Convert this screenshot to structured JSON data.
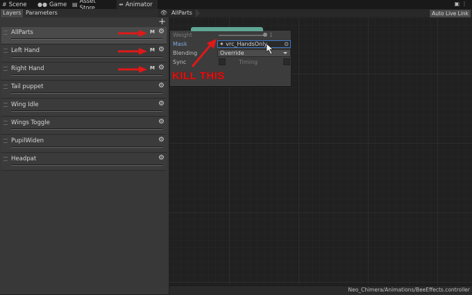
{
  "tabs": [
    {
      "label": "Scene",
      "icon": "grid-icon"
    },
    {
      "label": "Game",
      "icon": "gamepad-icon"
    },
    {
      "label": "Asset Store",
      "icon": "store-icon"
    },
    {
      "label": "Animator",
      "icon": "animator-icon"
    }
  ],
  "subtabs": [
    "Layers",
    "Parameters"
  ],
  "add_symbol": "+",
  "layers": [
    {
      "name": "AllParts",
      "badge": "M",
      "selected": true
    },
    {
      "name": "Left Hand",
      "badge": "M"
    },
    {
      "name": "Right Hand",
      "badge": "M"
    },
    {
      "name": "Tail puppet"
    },
    {
      "name": "Wing Idle"
    },
    {
      "name": "Wings Toggle"
    },
    {
      "name": "PupilWiden"
    },
    {
      "name": "Headpat"
    }
  ],
  "breadcrumb": "AllParts",
  "auto_live_link": "Auto Live Link",
  "popup": {
    "weight_label": "Weight",
    "weight_value": "1",
    "mask_label": "Mask",
    "mask_value": "vrc_HandsOnly",
    "blending_label": "Blending",
    "blending_value": "Override",
    "sync_label": "Sync",
    "timing_label": "Timing"
  },
  "annotation": "KILL THIS",
  "status_path": "Neo_Chimera/Animations/BeeEffects.controller",
  "colors": {
    "annotation": "#e01818",
    "layer_header": "#5fa694",
    "mask_label": "#7ea8e0"
  }
}
